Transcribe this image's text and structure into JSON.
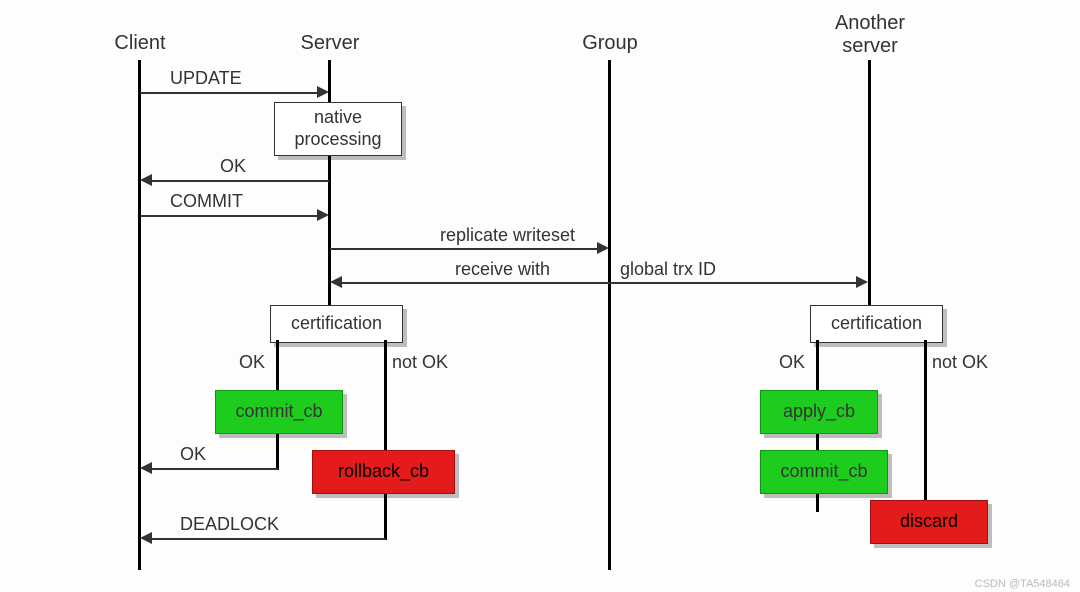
{
  "lifelines": {
    "client": "Client",
    "server": "Server",
    "group": "Group",
    "another": "Another\nserver"
  },
  "messages": {
    "update": "UPDATE",
    "ok1": "OK",
    "commit": "COMMIT",
    "replicate": "replicate writeset",
    "receive": "receive with",
    "global_trx": "global trx ID",
    "ok_left": "OK",
    "notok_left": "not OK",
    "ok_right": "OK",
    "notok_right": "not OK",
    "ok2": "OK",
    "deadlock": "DEADLOCK"
  },
  "boxes": {
    "native": "native\nprocessing",
    "cert_left": "certification",
    "commit_cb_left": "commit_cb",
    "rollback_cb": "rollback_cb",
    "cert_right": "certification",
    "apply_cb": "apply_cb",
    "commit_cb_right": "commit_cb",
    "discard": "discard"
  },
  "watermark": "CSDN @TA548464",
  "chart_data": {
    "type": "sequence-diagram",
    "participants": [
      "Client",
      "Server",
      "Group",
      "Another server"
    ],
    "interactions": [
      {
        "from": "Client",
        "to": "Server",
        "label": "UPDATE"
      },
      {
        "at": "Server",
        "action": "native processing"
      },
      {
        "from": "Server",
        "to": "Client",
        "label": "OK"
      },
      {
        "from": "Client",
        "to": "Server",
        "label": "COMMIT"
      },
      {
        "from": "Server",
        "to": "Group",
        "label": "replicate writeset"
      },
      {
        "from": "Group",
        "to": [
          "Server",
          "Another server"
        ],
        "label": "receive with global trx ID"
      },
      {
        "at": "Server",
        "action": "certification",
        "branches": [
          {
            "cond": "OK",
            "actions": [
              "commit_cb",
              {
                "to": "Client",
                "label": "OK"
              }
            ]
          },
          {
            "cond": "not OK",
            "actions": [
              "rollback_cb",
              {
                "to": "Client",
                "label": "DEADLOCK"
              }
            ]
          }
        ]
      },
      {
        "at": "Another server",
        "action": "certification",
        "branches": [
          {
            "cond": "OK",
            "actions": [
              "apply_cb",
              "commit_cb"
            ]
          },
          {
            "cond": "not OK",
            "actions": [
              "discard"
            ]
          }
        ]
      }
    ]
  }
}
